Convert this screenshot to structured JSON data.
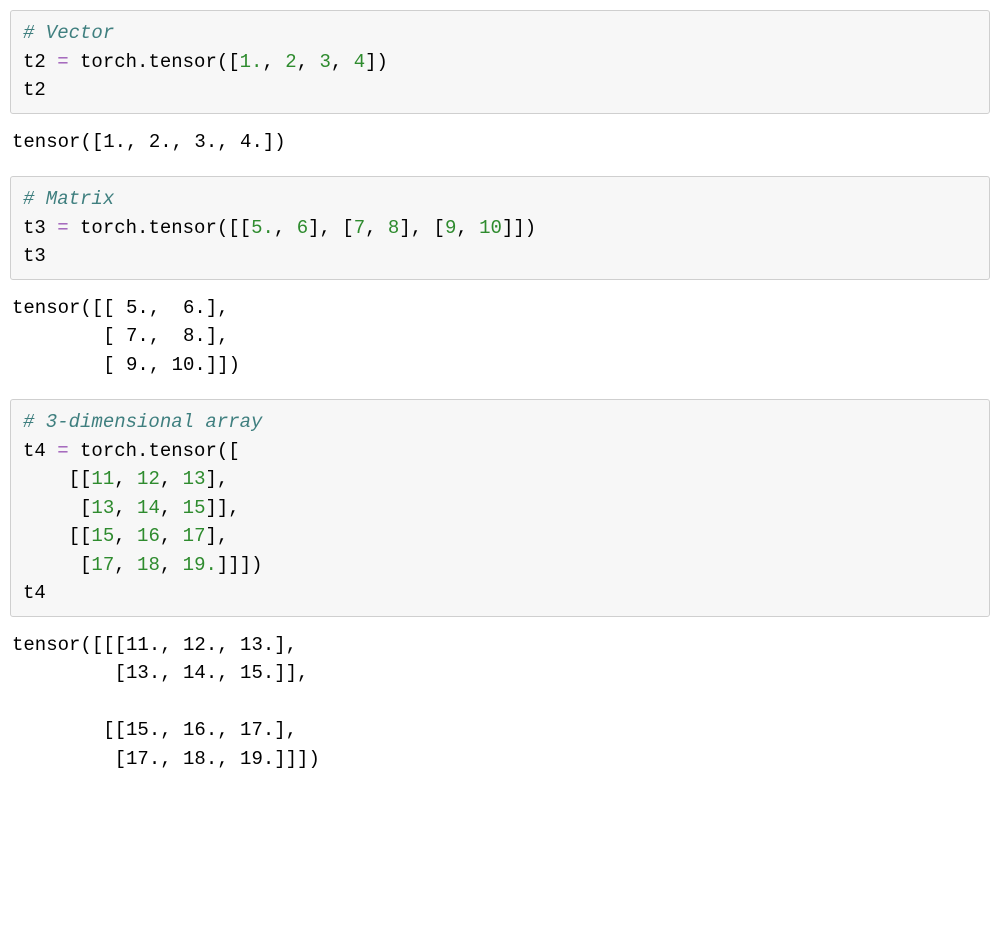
{
  "cells": [
    {
      "input_tokens": [
        {
          "cls": "comment",
          "t": "# Vector"
        },
        {
          "cls": "plain",
          "t": "\nt2 "
        },
        {
          "cls": "operator",
          "t": "="
        },
        {
          "cls": "plain",
          "t": " torch.tensor(["
        },
        {
          "cls": "number",
          "t": "1."
        },
        {
          "cls": "plain",
          "t": ", "
        },
        {
          "cls": "number",
          "t": "2"
        },
        {
          "cls": "plain",
          "t": ", "
        },
        {
          "cls": "number",
          "t": "3"
        },
        {
          "cls": "plain",
          "t": ", "
        },
        {
          "cls": "number",
          "t": "4"
        },
        {
          "cls": "plain",
          "t": "])\nt2"
        }
      ],
      "output": "tensor([1., 2., 3., 4.])"
    },
    {
      "input_tokens": [
        {
          "cls": "comment",
          "t": "# Matrix"
        },
        {
          "cls": "plain",
          "t": "\nt3 "
        },
        {
          "cls": "operator",
          "t": "="
        },
        {
          "cls": "plain",
          "t": " torch.tensor([["
        },
        {
          "cls": "number",
          "t": "5."
        },
        {
          "cls": "plain",
          "t": ", "
        },
        {
          "cls": "number",
          "t": "6"
        },
        {
          "cls": "plain",
          "t": "], ["
        },
        {
          "cls": "number",
          "t": "7"
        },
        {
          "cls": "plain",
          "t": ", "
        },
        {
          "cls": "number",
          "t": "8"
        },
        {
          "cls": "plain",
          "t": "], ["
        },
        {
          "cls": "number",
          "t": "9"
        },
        {
          "cls": "plain",
          "t": ", "
        },
        {
          "cls": "number",
          "t": "10"
        },
        {
          "cls": "plain",
          "t": "]])\nt3"
        }
      ],
      "output": "tensor([[ 5.,  6.],\n        [ 7.,  8.],\n        [ 9., 10.]])"
    },
    {
      "input_tokens": [
        {
          "cls": "comment",
          "t": "# 3-dimensional array"
        },
        {
          "cls": "plain",
          "t": "\nt4 "
        },
        {
          "cls": "operator",
          "t": "="
        },
        {
          "cls": "plain",
          "t": " torch.tensor([\n    [["
        },
        {
          "cls": "number",
          "t": "11"
        },
        {
          "cls": "plain",
          "t": ", "
        },
        {
          "cls": "number",
          "t": "12"
        },
        {
          "cls": "plain",
          "t": ", "
        },
        {
          "cls": "number",
          "t": "13"
        },
        {
          "cls": "plain",
          "t": "], \n     ["
        },
        {
          "cls": "number",
          "t": "13"
        },
        {
          "cls": "plain",
          "t": ", "
        },
        {
          "cls": "number",
          "t": "14"
        },
        {
          "cls": "plain",
          "t": ", "
        },
        {
          "cls": "number",
          "t": "15"
        },
        {
          "cls": "plain",
          "t": "]], \n    [["
        },
        {
          "cls": "number",
          "t": "15"
        },
        {
          "cls": "plain",
          "t": ", "
        },
        {
          "cls": "number",
          "t": "16"
        },
        {
          "cls": "plain",
          "t": ", "
        },
        {
          "cls": "number",
          "t": "17"
        },
        {
          "cls": "plain",
          "t": "], \n     ["
        },
        {
          "cls": "number",
          "t": "17"
        },
        {
          "cls": "plain",
          "t": ", "
        },
        {
          "cls": "number",
          "t": "18"
        },
        {
          "cls": "plain",
          "t": ", "
        },
        {
          "cls": "number",
          "t": "19."
        },
        {
          "cls": "plain",
          "t": "]]])\nt4"
        }
      ],
      "output": "tensor([[[11., 12., 13.],\n         [13., 14., 15.]],\n\n        [[15., 16., 17.],\n         [17., 18., 19.]]])"
    }
  ]
}
